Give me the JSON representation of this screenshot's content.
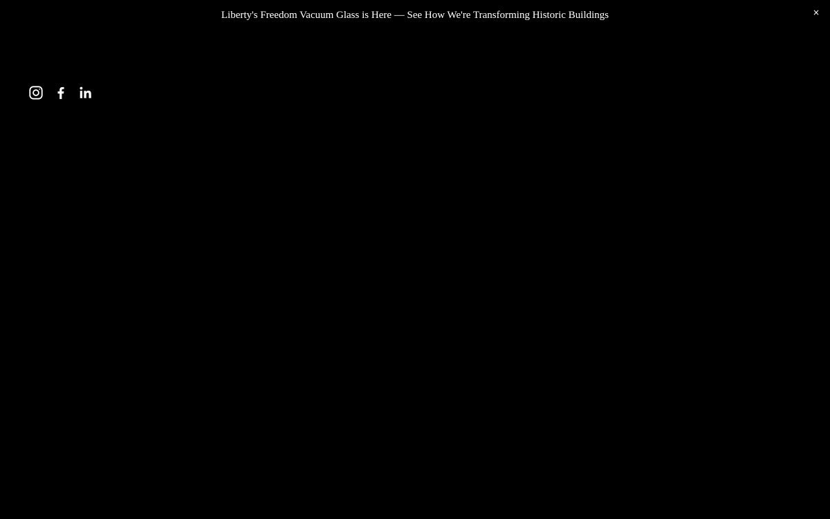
{
  "announcement": {
    "text": "Liberty's Freedom Vacuum Glass is Here — See How We're Transforming Historic Buildings",
    "close_label": "×"
  },
  "social": {
    "items": [
      {
        "name": "instagram",
        "icon": "instagram-icon"
      },
      {
        "name": "facebook",
        "icon": "facebook-icon"
      },
      {
        "name": "linkedin",
        "icon": "linkedin-icon"
      }
    ]
  },
  "colors": {
    "background": "#000000",
    "text": "#ffffff"
  }
}
